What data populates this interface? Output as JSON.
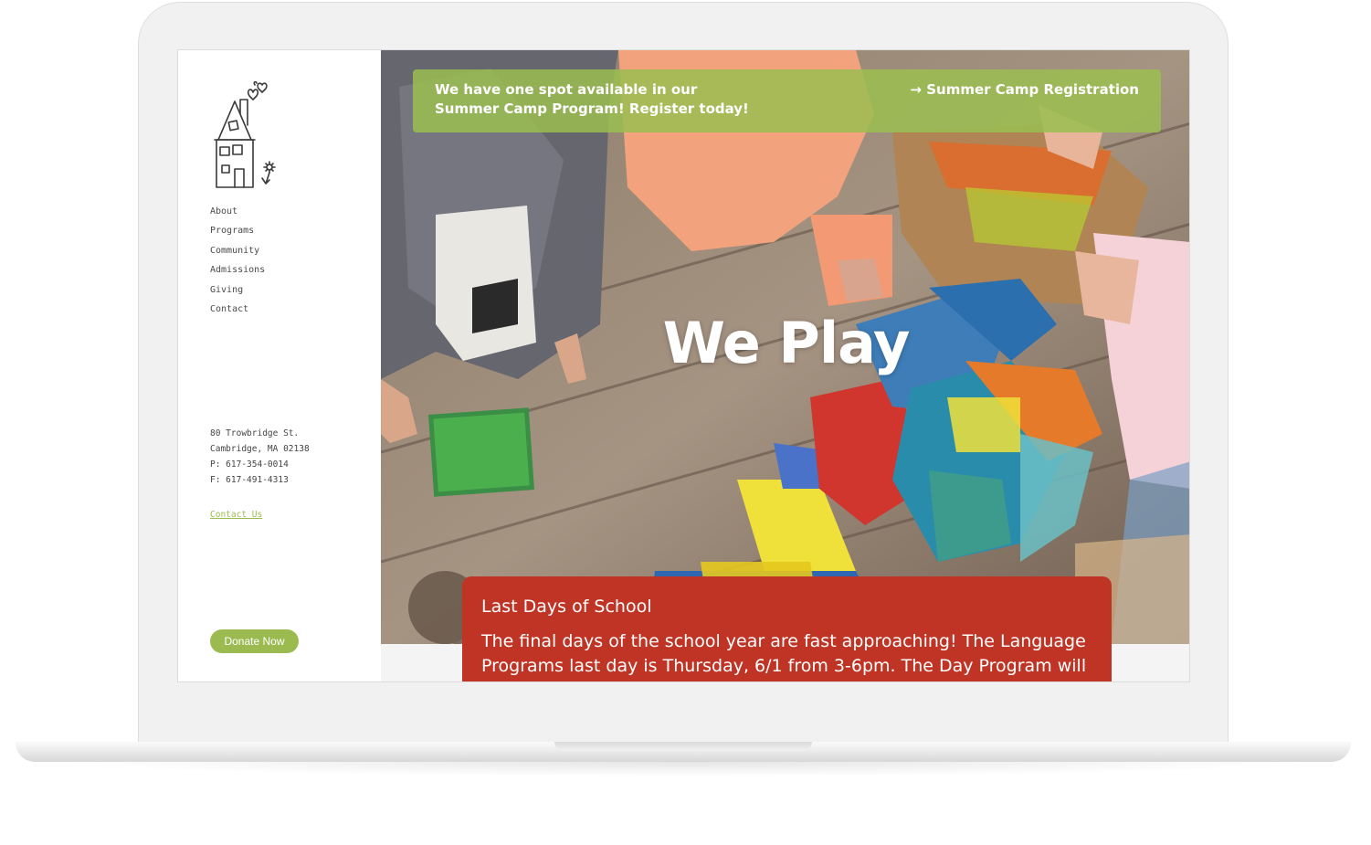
{
  "sidebar": {
    "nav": [
      "About",
      "Programs",
      "Community",
      "Admissions",
      "Giving",
      "Contact"
    ],
    "address": {
      "line1": "80 Trowbridge St.",
      "line2": "Cambridge, MA 02138",
      "phone": "P: 617-354-0014",
      "fax": "F: 617-491-4313"
    },
    "contact_link": "Contact Us",
    "donate_label": "Donate Now"
  },
  "banner": {
    "text": "We have one spot available in our Summer Camp Program! Register today!",
    "link_arrow": "→",
    "link_label": "Summer Camp Registration"
  },
  "hero": {
    "title": "We Play"
  },
  "news": {
    "title": "Last Days of School",
    "body": "The final days of the school year are fast approaching! The Language Programs last day is Thursday, 6/1 from 3-6pm. The Day Program will"
  },
  "colors": {
    "accent_green": "#9bbb50",
    "card_red": "#c03425"
  }
}
